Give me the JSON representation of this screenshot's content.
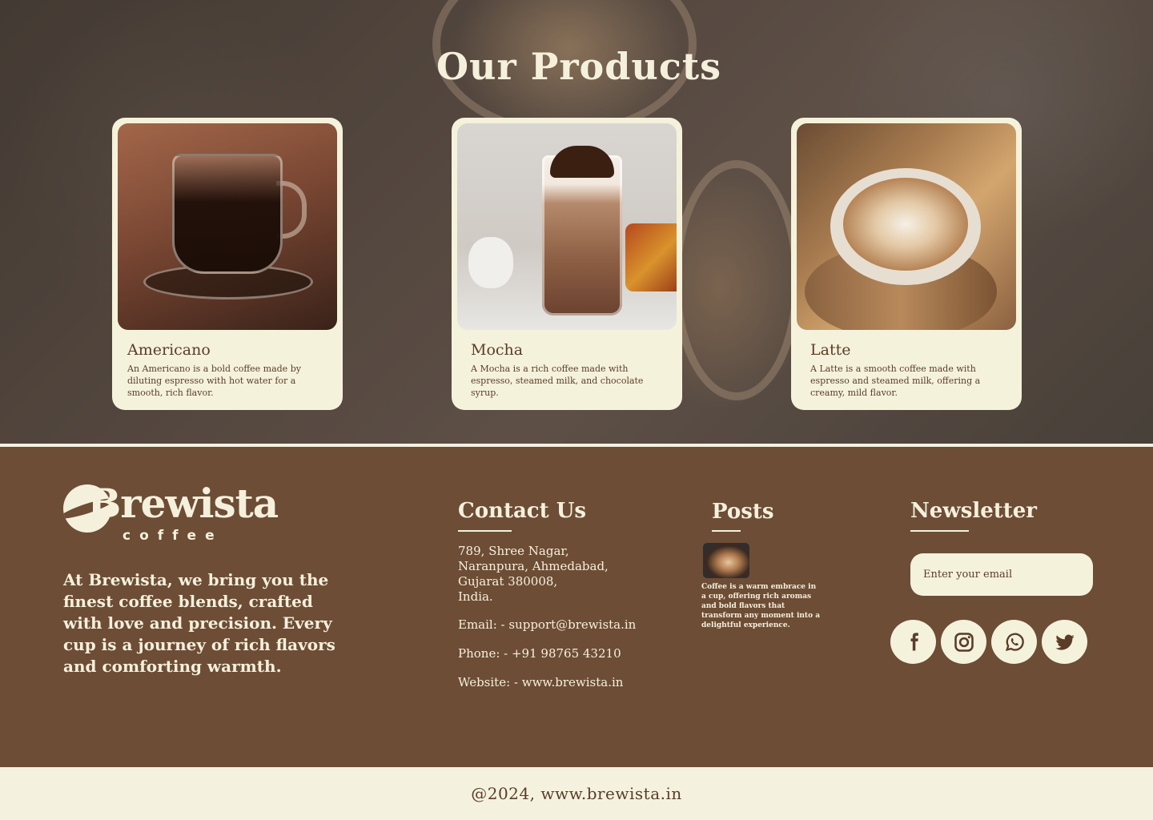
{
  "products_section": {
    "title": "Our Products",
    "items": [
      {
        "name": "Americano",
        "description": "An Americano is a bold coffee made by diluting espresso with hot water for a smooth, rich flavor."
      },
      {
        "name": "Mocha",
        "description": "A Mocha is a rich coffee made with espresso, steamed milk, and chocolate syrup."
      },
      {
        "name": "Latte",
        "description": "A Latte is a smooth coffee made with espresso and steamed milk, offering a creamy, mild flavor."
      }
    ]
  },
  "footer": {
    "logo": {
      "word": "Brewista",
      "sub": "coffee"
    },
    "about": "At Brewista, we bring you the finest coffee blends, crafted with love and precision. Every cup is a journey of rich flavors and comforting warmth.",
    "contact": {
      "title": "Contact Us",
      "address": [
        "789, Shree Nagar,",
        "Naranpura, Ahmedabad,",
        "Gujarat 380008,",
        "India."
      ],
      "email": "Email: - support@brewista.in",
      "phone": "Phone: - +91 98765 43210",
      "website": "Website: - www.brewista.in"
    },
    "posts": {
      "title": "Posts",
      "items": [
        {
          "text": "Coffee is a warm embrace in a cup, offering rich aromas and bold flavors that transform any moment into a delightful experience."
        }
      ]
    },
    "newsletter": {
      "title": "Newsletter",
      "placeholder": "Enter your email",
      "value": ""
    },
    "social": [
      {
        "icon": "facebook-icon"
      },
      {
        "icon": "instagram-icon"
      },
      {
        "icon": "whatsapp-icon"
      },
      {
        "icon": "twitter-icon"
      }
    ]
  },
  "copyright": "@2024, www.brewista.in",
  "colors": {
    "footer_bg": "#6d4d36",
    "cream": "#f5f2dc",
    "text_brown": "#5a3d28"
  }
}
